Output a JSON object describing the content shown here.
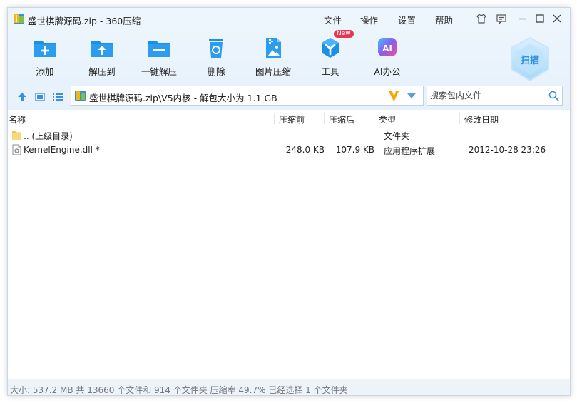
{
  "window": {
    "title": "盛世棋牌源码.zip - 360压缩",
    "menu": [
      "文件",
      "操作",
      "设置",
      "帮助"
    ]
  },
  "toolbar": {
    "items": [
      {
        "label": "添加",
        "icon": "add-icon"
      },
      {
        "label": "解压到",
        "icon": "extract-to-icon"
      },
      {
        "label": "一键解压",
        "icon": "one-click-extract-icon"
      },
      {
        "label": "删除",
        "icon": "delete-icon"
      },
      {
        "label": "图片压缩",
        "icon": "image-compress-icon"
      },
      {
        "label": "工具",
        "icon": "tools-icon",
        "badge": "New"
      },
      {
        "label": "AI办公",
        "icon": "ai-office-icon",
        "glyph": "AI"
      }
    ],
    "scan_label": "扫描"
  },
  "address": {
    "path": "盛世棋牌源码.zip\\V5内核 - 解包大小为 1.1 GB"
  },
  "search": {
    "placeholder": "搜索包内文件"
  },
  "columns": {
    "name": "名称",
    "packed": "压缩前",
    "compressed": "压缩后",
    "type": "类型",
    "modified": "修改日期"
  },
  "rows": [
    {
      "name": ".. (上级目录)",
      "packed": "",
      "compressed": "",
      "type": "文件夹",
      "modified": "",
      "icon": "folder-icon"
    },
    {
      "name": "KernelEngine.dll *",
      "packed": "248.0 KB",
      "compressed": "107.9 KB",
      "type": "应用程序扩展",
      "modified": "2012-10-28 23:26",
      "icon": "dll-file-icon"
    }
  ],
  "status": {
    "text": "大小: 537.2 MB 共 13660 个文件和 914 个文件夹 压缩率 49.7% 已经选择 1 个文件夹"
  },
  "colors": {
    "accent_blue": "#1a8fe6",
    "header_bg": "#eaf4fd",
    "new_badge": "#e8364f",
    "v_logo": "#f5a800"
  }
}
